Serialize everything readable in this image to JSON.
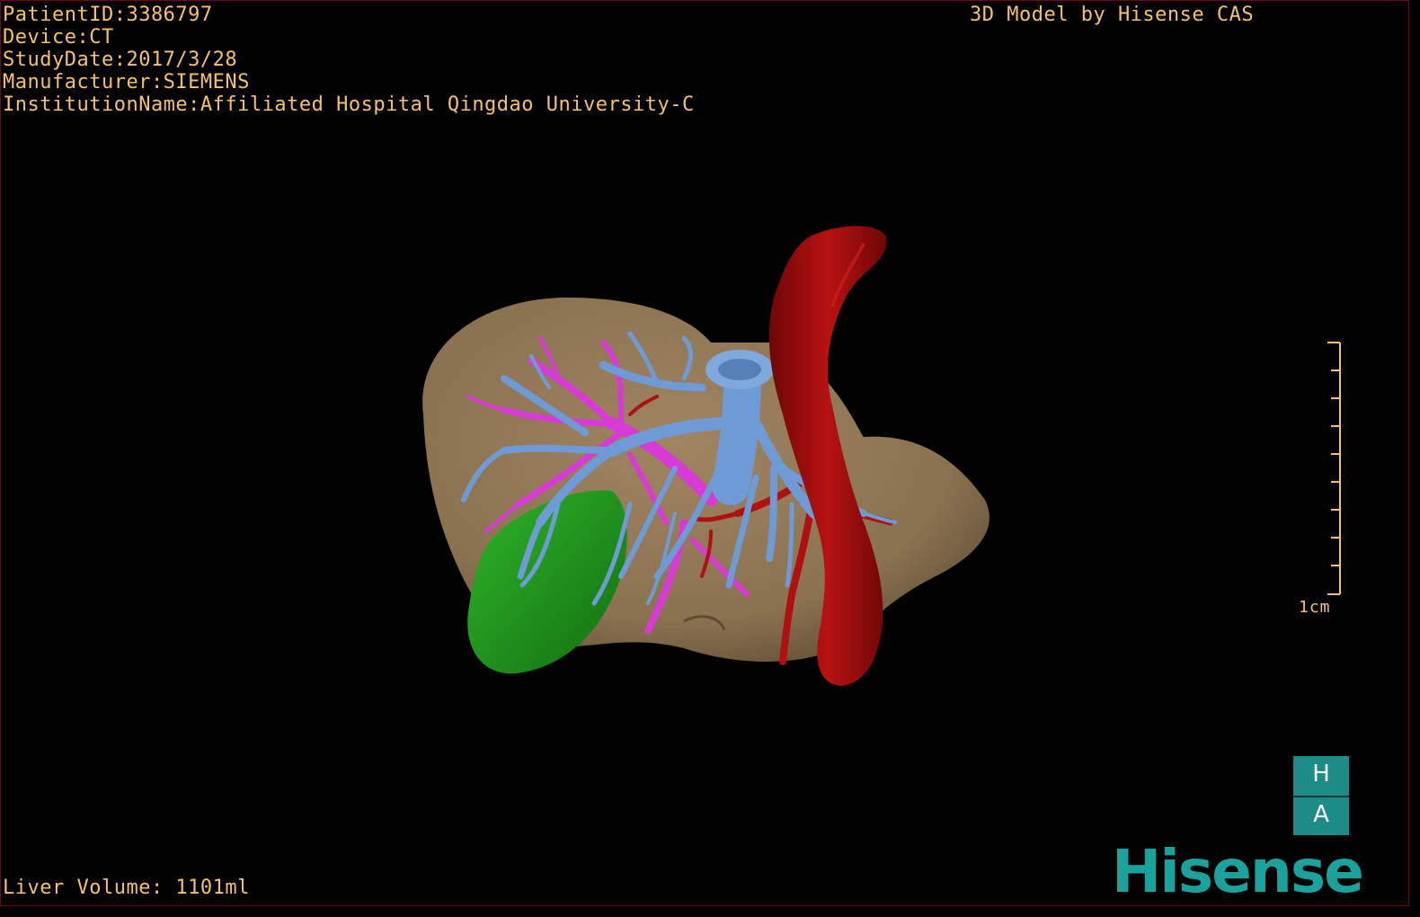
{
  "header": {
    "patient_id": "PatientID:3386797",
    "device": "Device:CT",
    "study_date": "StudyDate:2017/3/28",
    "manufacturer": "Manufacturer:SIEMENS",
    "institution": "InstitutionName:Affiliated Hospital Qingdao University-C",
    "credit": "3D Model by Hisense CAS"
  },
  "footer": {
    "liver_volume": "Liver Volume: 1101ml"
  },
  "scale_bar": {
    "label": "1cm"
  },
  "orientation": {
    "top_letter": "H",
    "bottom_letter": "A"
  },
  "logo": {
    "text": "Hisense"
  },
  "colors": {
    "overlay_text": "#f5c26b",
    "liver": "#8a7150",
    "portal_vein": "#6e9bd6",
    "hepatic_vein": "#d83ad6",
    "artery_aorta": "#a30c0c",
    "gallbladder": "#1c8d1a",
    "brand": "#1aa39c"
  }
}
